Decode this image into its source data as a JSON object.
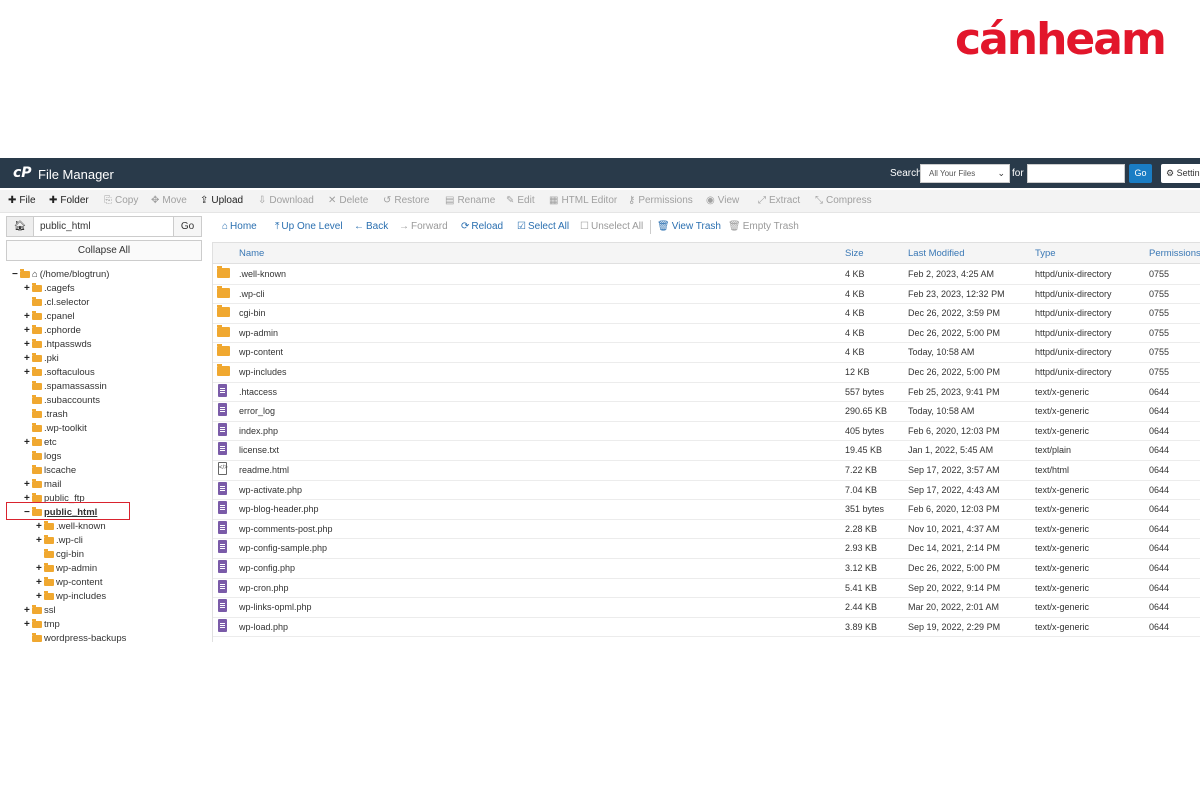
{
  "brand": {
    "logo_text": "cánheam",
    "color": "#e2162b"
  },
  "topbar": {
    "title": "File Manager",
    "search_label": "Search",
    "search_scope": "All Your Files",
    "for_label": "for",
    "go_label": "Go",
    "settings_label": "Settin",
    "bg_color": "#293a4a"
  },
  "toolbar": [
    {
      "label": "File",
      "icon": "plus-icon",
      "enabled": true
    },
    {
      "label": "Folder",
      "icon": "plus-icon",
      "enabled": true
    },
    {
      "label": "Copy",
      "icon": "copy-icon",
      "enabled": false
    },
    {
      "label": "Move",
      "icon": "move-icon",
      "enabled": false
    },
    {
      "label": "Upload",
      "icon": "upload-icon",
      "enabled": true
    },
    {
      "label": "Download",
      "icon": "download-icon",
      "enabled": false
    },
    {
      "label": "Delete",
      "icon": "delete-icon",
      "enabled": false
    },
    {
      "label": "Restore",
      "icon": "restore-icon",
      "enabled": false
    },
    {
      "label": "Rename",
      "icon": "rename-icon",
      "enabled": false
    },
    {
      "label": "Edit",
      "icon": "edit-icon",
      "enabled": false
    },
    {
      "label": "HTML Editor",
      "icon": "html-editor-icon",
      "enabled": false
    },
    {
      "label": "Permissions",
      "icon": "key-icon",
      "enabled": false
    },
    {
      "label": "View",
      "icon": "eye-icon",
      "enabled": false
    },
    {
      "label": "Extract",
      "icon": "extract-icon",
      "enabled": false
    },
    {
      "label": "Compress",
      "icon": "compress-icon",
      "enabled": false
    }
  ],
  "left": {
    "path_value": "public_html",
    "go_label": "Go",
    "collapse_label": "Collapse All",
    "tree": [
      {
        "label": "(/home/blogtrun)",
        "toggle": "−",
        "level": 0,
        "home": true
      },
      {
        "label": ".cagefs",
        "toggle": "+",
        "level": 1
      },
      {
        "label": ".cl.selector",
        "toggle": "",
        "level": 1
      },
      {
        "label": ".cpanel",
        "toggle": "+",
        "level": 1
      },
      {
        "label": ".cphorde",
        "toggle": "+",
        "level": 1
      },
      {
        "label": ".htpasswds",
        "toggle": "+",
        "level": 1
      },
      {
        "label": ".pki",
        "toggle": "+",
        "level": 1
      },
      {
        "label": ".softaculous",
        "toggle": "+",
        "level": 1
      },
      {
        "label": ".spamassassin",
        "toggle": "",
        "level": 1
      },
      {
        "label": ".subaccounts",
        "toggle": "",
        "level": 1
      },
      {
        "label": ".trash",
        "toggle": "",
        "level": 1
      },
      {
        "label": ".wp-toolkit",
        "toggle": "",
        "level": 1
      },
      {
        "label": "etc",
        "toggle": "+",
        "level": 1
      },
      {
        "label": "logs",
        "toggle": "",
        "level": 1
      },
      {
        "label": "lscache",
        "toggle": "",
        "level": 1
      },
      {
        "label": "mail",
        "toggle": "+",
        "level": 1
      },
      {
        "label": "public_ftp",
        "toggle": "+",
        "level": 1
      },
      {
        "label": "public_html",
        "toggle": "−",
        "level": 1,
        "selected": true
      },
      {
        "label": ".well-known",
        "toggle": "+",
        "level": 2
      },
      {
        "label": ".wp-cli",
        "toggle": "+",
        "level": 2
      },
      {
        "label": "cgi-bin",
        "toggle": "",
        "level": 2
      },
      {
        "label": "wp-admin",
        "toggle": "+",
        "level": 2
      },
      {
        "label": "wp-content",
        "toggle": "+",
        "level": 2
      },
      {
        "label": "wp-includes",
        "toggle": "+",
        "level": 2
      },
      {
        "label": "ssl",
        "toggle": "+",
        "level": 1
      },
      {
        "label": "tmp",
        "toggle": "+",
        "level": 1
      },
      {
        "label": "wordpress-backups",
        "toggle": "",
        "level": 1
      }
    ]
  },
  "navbar": [
    {
      "label": "Home",
      "icon": "home-icon",
      "enabled": true
    },
    {
      "label": "Up One Level",
      "icon": "up-icon",
      "enabled": true
    },
    {
      "label": "Back",
      "icon": "back-arrow-icon",
      "enabled": true
    },
    {
      "label": "Forward",
      "icon": "forward-arrow-icon",
      "enabled": false
    },
    {
      "label": "Reload",
      "icon": "reload-icon",
      "enabled": true
    },
    {
      "label": "Select All",
      "icon": "checkbox-checked-icon",
      "enabled": true
    },
    {
      "label": "Unselect All",
      "icon": "checkbox-icon",
      "enabled": false
    },
    {
      "label": "View Trash",
      "icon": "trash-icon",
      "enabled": true
    },
    {
      "label": "Empty Trash",
      "icon": "trash-icon",
      "enabled": false
    }
  ],
  "table": {
    "headers": {
      "name": "Name",
      "size": "Size",
      "modified": "Last Modified",
      "type": "Type",
      "perms": "Permissions"
    },
    "rows": [
      {
        "icon": "folder",
        "name": ".well-known",
        "size": "4 KB",
        "modified": "Feb 2, 2023, 4:25 AM",
        "type": "httpd/unix-directory",
        "perms": "0755"
      },
      {
        "icon": "folder",
        "name": ".wp-cli",
        "size": "4 KB",
        "modified": "Feb 23, 2023, 12:32 PM",
        "type": "httpd/unix-directory",
        "perms": "0755"
      },
      {
        "icon": "folder",
        "name": "cgi-bin",
        "size": "4 KB",
        "modified": "Dec 26, 2022, 3:59 PM",
        "type": "httpd/unix-directory",
        "perms": "0755"
      },
      {
        "icon": "folder",
        "name": "wp-admin",
        "size": "4 KB",
        "modified": "Dec 26, 2022, 5:00 PM",
        "type": "httpd/unix-directory",
        "perms": "0755"
      },
      {
        "icon": "folder",
        "name": "wp-content",
        "size": "4 KB",
        "modified": "Today, 10:58 AM",
        "type": "httpd/unix-directory",
        "perms": "0755"
      },
      {
        "icon": "folder",
        "name": "wp-includes",
        "size": "12 KB",
        "modified": "Dec 26, 2022, 5:00 PM",
        "type": "httpd/unix-directory",
        "perms": "0755"
      },
      {
        "icon": "file",
        "name": ".htaccess",
        "size": "557 bytes",
        "modified": "Feb 25, 2023, 9:41 PM",
        "type": "text/x-generic",
        "perms": "0644"
      },
      {
        "icon": "file",
        "name": "error_log",
        "size": "290.65 KB",
        "modified": "Today, 10:58 AM",
        "type": "text/x-generic",
        "perms": "0644"
      },
      {
        "icon": "file",
        "name": "index.php",
        "size": "405 bytes",
        "modified": "Feb 6, 2020, 12:03 PM",
        "type": "text/x-generic",
        "perms": "0644"
      },
      {
        "icon": "file",
        "name": "license.txt",
        "size": "19.45 KB",
        "modified": "Jan 1, 2022, 5:45 AM",
        "type": "text/plain",
        "perms": "0644"
      },
      {
        "icon": "html",
        "name": "readme.html",
        "size": "7.22 KB",
        "modified": "Sep 17, 2022, 3:57 AM",
        "type": "text/html",
        "perms": "0644"
      },
      {
        "icon": "file",
        "name": "wp-activate.php",
        "size": "7.04 KB",
        "modified": "Sep 17, 2022, 4:43 AM",
        "type": "text/x-generic",
        "perms": "0644"
      },
      {
        "icon": "file",
        "name": "wp-blog-header.php",
        "size": "351 bytes",
        "modified": "Feb 6, 2020, 12:03 PM",
        "type": "text/x-generic",
        "perms": "0644"
      },
      {
        "icon": "file",
        "name": "wp-comments-post.php",
        "size": "2.28 KB",
        "modified": "Nov 10, 2021, 4:37 AM",
        "type": "text/x-generic",
        "perms": "0644"
      },
      {
        "icon": "file",
        "name": "wp-config-sample.php",
        "size": "2.93 KB",
        "modified": "Dec 14, 2021, 2:14 PM",
        "type": "text/x-generic",
        "perms": "0644"
      },
      {
        "icon": "file",
        "name": "wp-config.php",
        "size": "3.12 KB",
        "modified": "Dec 26, 2022, 5:00 PM",
        "type": "text/x-generic",
        "perms": "0644"
      },
      {
        "icon": "file",
        "name": "wp-cron.php",
        "size": "5.41 KB",
        "modified": "Sep 20, 2022, 9:14 PM",
        "type": "text/x-generic",
        "perms": "0644"
      },
      {
        "icon": "file",
        "name": "wp-links-opml.php",
        "size": "2.44 KB",
        "modified": "Mar 20, 2022, 2:01 AM",
        "type": "text/x-generic",
        "perms": "0644"
      },
      {
        "icon": "file",
        "name": "wp-load.php",
        "size": "3.89 KB",
        "modified": "Sep 19, 2022, 2:29 PM",
        "type": "text/x-generic",
        "perms": "0644"
      }
    ]
  }
}
